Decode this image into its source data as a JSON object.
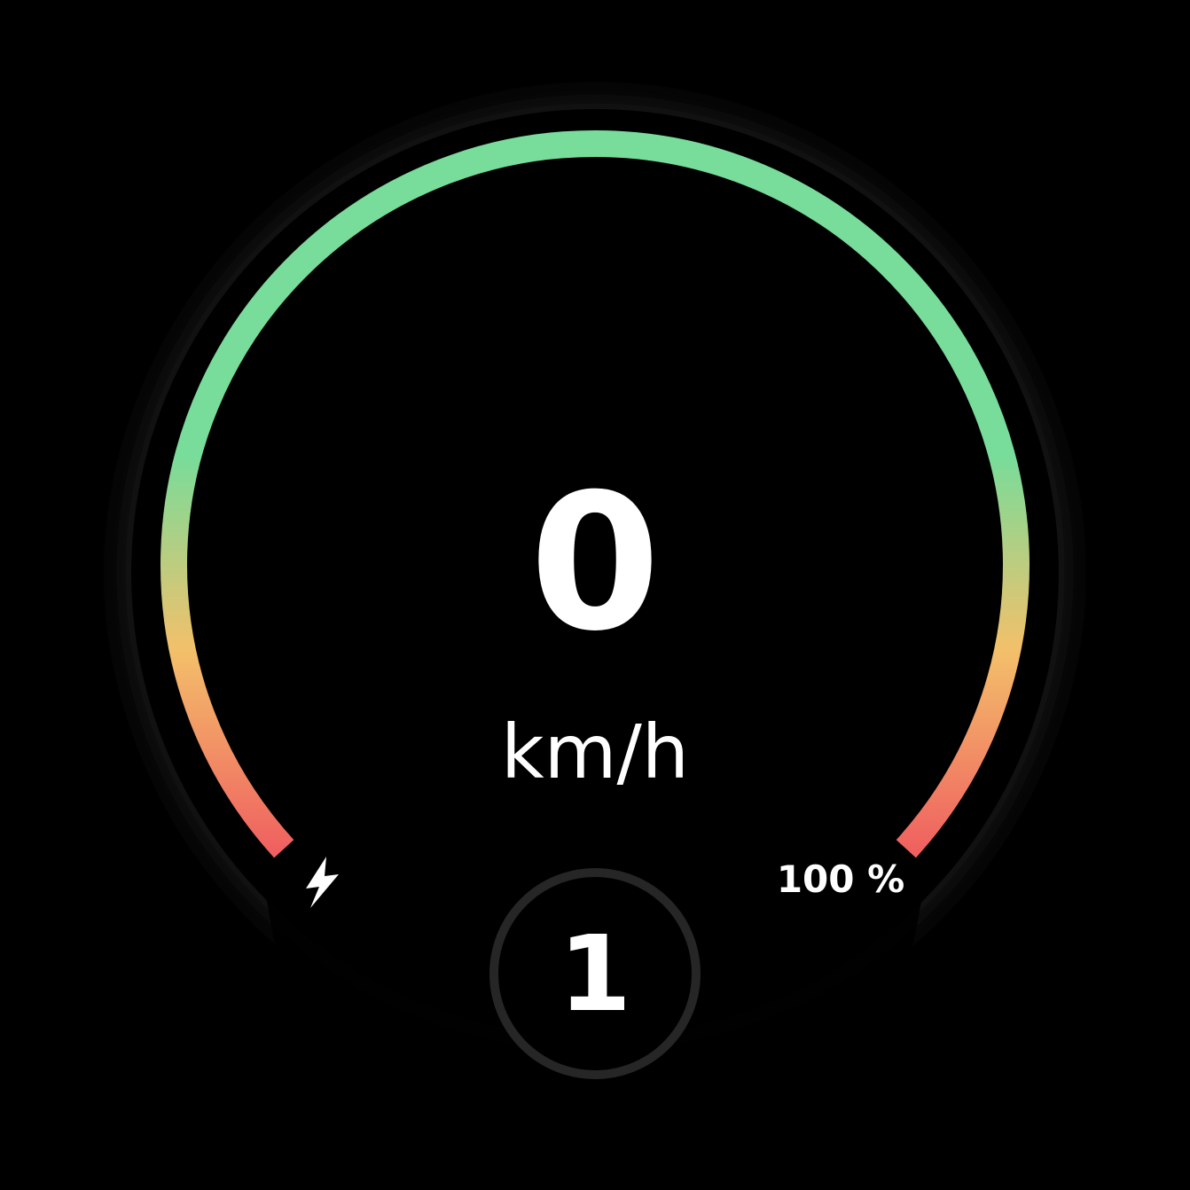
{
  "speedometer": {
    "speed_value": "0",
    "speed_unit": "km/h"
  },
  "battery": {
    "level_percent": 100,
    "label": "100 %",
    "icon": "lightning-bolt-icon"
  },
  "gear": {
    "value": "1"
  },
  "colors": {
    "background": "#000000",
    "arc_full": "#78dc9a",
    "arc_mid": "#f3c06a",
    "arc_low": "#f06060",
    "gear_ring": "#262626",
    "text": "#ffffff"
  }
}
